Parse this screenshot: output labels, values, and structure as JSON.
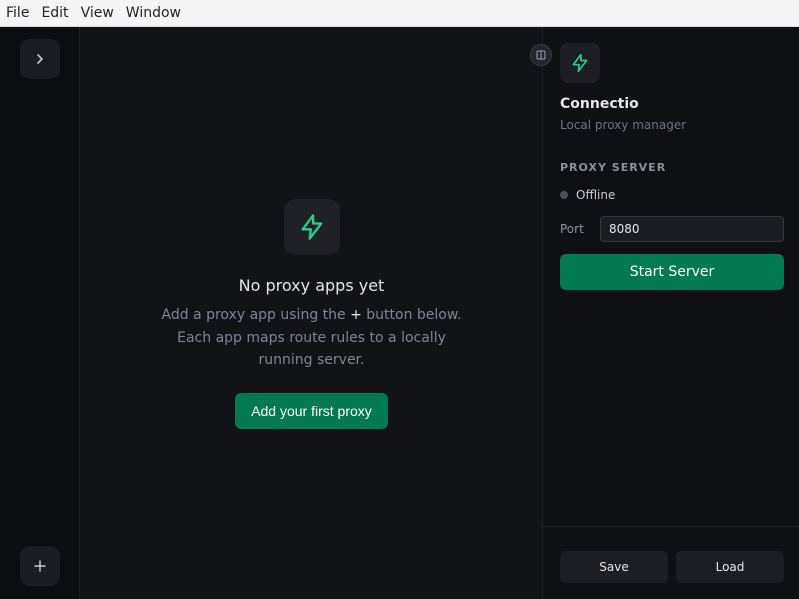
{
  "menubar": {
    "items": [
      "File",
      "Edit",
      "View",
      "Window"
    ]
  },
  "rail": {
    "expand_icon": "chevron-right-icon",
    "add_icon": "plus-icon"
  },
  "main": {
    "empty_icon": "lightning-bolt-icon",
    "empty_title": "No proxy apps yet",
    "empty_desc_before": "Add a proxy app using the ",
    "empty_desc_plus": "+",
    "empty_desc_after": " button below. Each app maps route rules to a locally running server.",
    "add_first_label": "Add your first proxy"
  },
  "panel": {
    "collapse_icon": "panel-toggle-icon",
    "logo_icon": "lightning-bolt-icon",
    "app_name": "Connectio",
    "app_subtitle": "Local proxy manager",
    "section_label": "PROXY SERVER",
    "status": "Offline",
    "port_label": "Port",
    "port_value": "8080",
    "start_label": "Start Server",
    "save_label": "Save",
    "load_label": "Load"
  },
  "colors": {
    "accent": "#037a52",
    "icon_green": "#2ecc8a",
    "background": "#121317",
    "status_offline": "#4a5060"
  }
}
